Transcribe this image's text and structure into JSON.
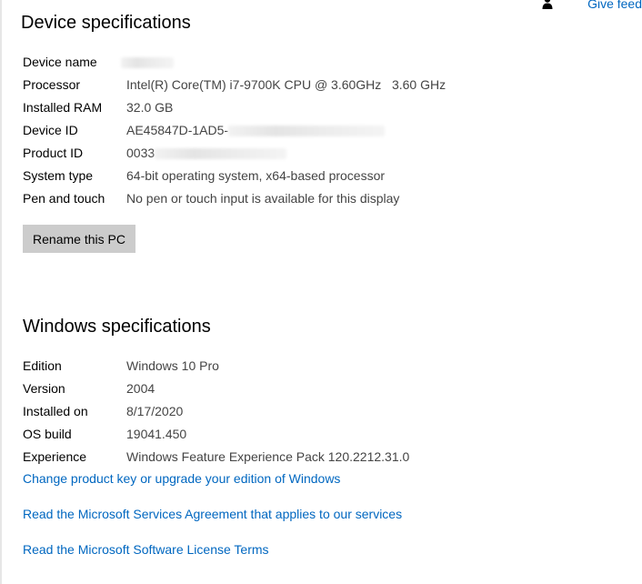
{
  "header": {
    "feedback_label": "Give feed"
  },
  "device_specs": {
    "title": "Device specifications",
    "rows": [
      {
        "label": "Device name",
        "value": ""
      },
      {
        "label": "Processor",
        "value": "Intel(R) Core(TM) i7-9700K CPU @ 3.60GHz   3.60 GHz"
      },
      {
        "label": "Installed RAM",
        "value": "32.0 GB"
      },
      {
        "label": "Device ID",
        "value": "AE45847D-1AD5-"
      },
      {
        "label": "Product ID",
        "value": "0033"
      },
      {
        "label": "System type",
        "value": "64-bit operating system, x64-based processor"
      },
      {
        "label": "Pen and touch",
        "value": "No pen or touch input is available for this display"
      }
    ],
    "rename_button": "Rename this PC"
  },
  "windows_specs": {
    "title": "Windows specifications",
    "rows": [
      {
        "label": "Edition",
        "value": "Windows 10 Pro"
      },
      {
        "label": "Version",
        "value": "2004"
      },
      {
        "label": "Installed on",
        "value": "8/17/2020"
      },
      {
        "label": "OS build",
        "value": "19041.450"
      },
      {
        "label": "Experience",
        "value": "Windows Feature Experience Pack 120.2212.31.0"
      }
    ]
  },
  "links": {
    "change_product_key": "Change product key or upgrade your edition of Windows",
    "services_agreement": "Read the Microsoft Services Agreement that applies to our services",
    "license_terms": "Read the Microsoft Software License Terms"
  },
  "colors": {
    "link": "#0067c0",
    "value_text": "#444444",
    "button_bg": "#cccccc"
  },
  "icons": {
    "feedback": "person-feedback-icon"
  }
}
